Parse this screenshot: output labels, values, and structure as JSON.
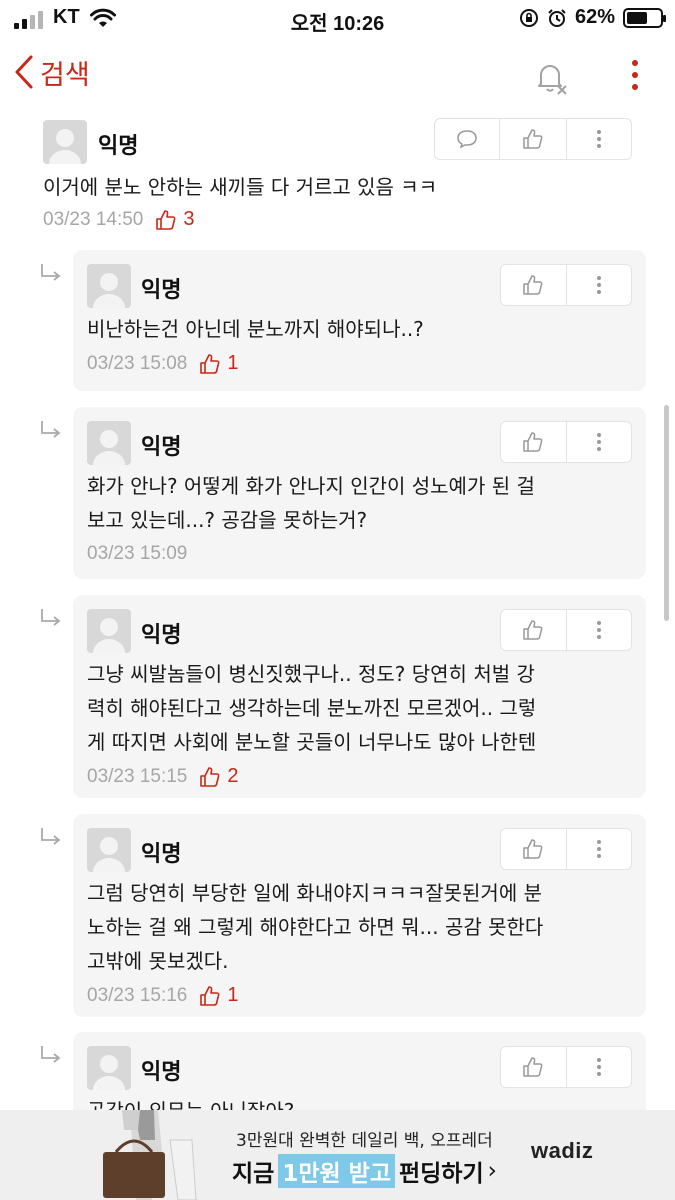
{
  "status_bar": {
    "carrier": "KT",
    "time": "오전 10:26",
    "battery": "62%",
    "battery_level": 0.62
  },
  "nav": {
    "back_label": "검색"
  },
  "comments": [
    {
      "author": "익명",
      "text": "이거에 분노 안하는 새끼들 다 거르고 있음 ㅋㅋ",
      "date": "03/23 14:50",
      "likes": "3"
    }
  ],
  "replies": [
    {
      "author": "익명",
      "text": "비난하는건 아닌데 분노까지 해야되나..?",
      "date": "03/23 15:08",
      "likes": "1"
    },
    {
      "author": "익명",
      "text": "화가 안나? 어떻게 화가 안나지 인간이 성노예가 된 걸\n보고 있는데...? 공감을 못하는거?",
      "date": "03/23 15:09",
      "likes": ""
    },
    {
      "author": "익명",
      "text": "그냥 씨발놈들이 병신짓했구나.. 정도? 당연히 처벌 강\n력히 해야된다고 생각하는데 분노까진 모르겠어.. 그렇\n게 따지면 사회에 분노할 곳들이 너무나도 많아 나한텐",
      "date": "03/23 15:15",
      "likes": "2"
    },
    {
      "author": "익명",
      "text": "그럼 당연히 부당한 일에 화내야지ㅋㅋㅋ잘못된거에 분\n노하는 걸 왜 그렇게 해야한다고 하면 뭐... 공감 못한다\n고밖에 못보겠다.",
      "date": "03/23 15:16",
      "likes": "1"
    },
    {
      "author": "익명",
      "text": "공감이 의무는 아니잖아?",
      "date": "",
      "likes": ""
    }
  ],
  "ad": {
    "line1": "3만원대 완벽한 데일리 백, 오프레더",
    "line2_prefix": "지금",
    "line2_highlight": "1만원 받고",
    "line2_suffix": "펀딩하기",
    "chevron": "›",
    "brand": "wadiz"
  },
  "colors": {
    "accent": "#c62917",
    "reply_bg": "#f5f5f5",
    "meta_text": "#a6a6a6"
  },
  "icons": [
    "back-chevron-icon",
    "bell-off-icon",
    "more-vertical-icon",
    "speech-bubble-icon",
    "thumbs-up-icon",
    "reply-arrow-icon"
  ]
}
